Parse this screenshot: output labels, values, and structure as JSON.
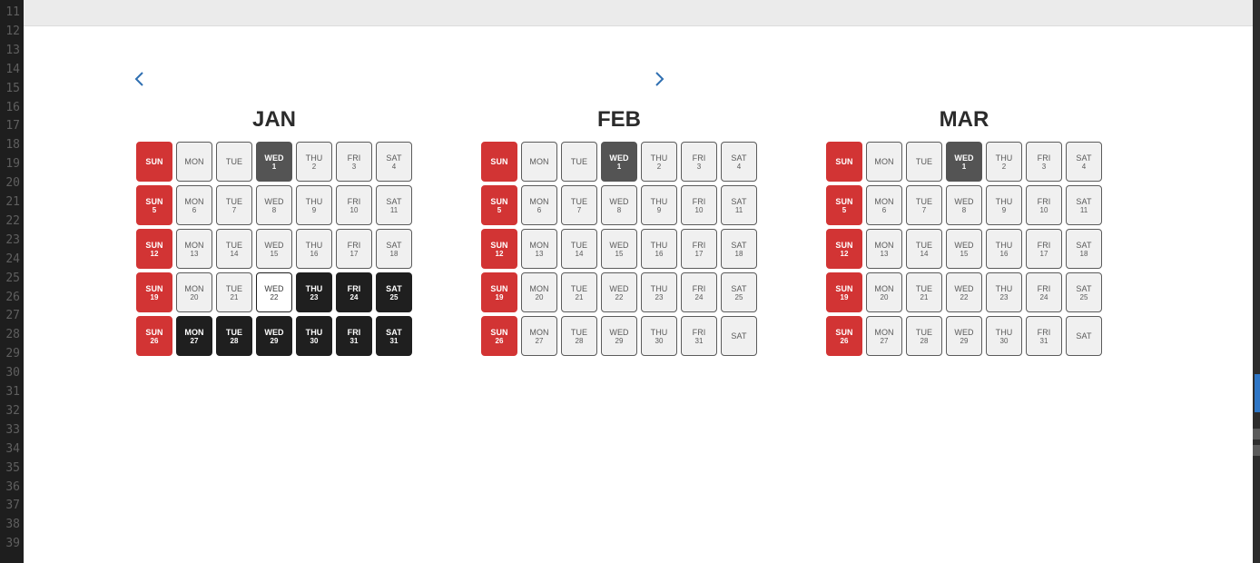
{
  "gutter_lines": [
    "11",
    "12",
    "13",
    "14",
    "15",
    "16",
    "17",
    "18",
    "19",
    "20",
    "21",
    "22",
    "23",
    "24",
    "25",
    "26",
    "27",
    "28",
    "29",
    "30",
    "31",
    "32",
    "33",
    "34",
    "35",
    "36",
    "37",
    "38",
    "39"
  ],
  "nav": {
    "prev_icon": "chevron-left-icon",
    "next_icon": "chevron-right-icon"
  },
  "colors": {
    "sunday": "#d23434",
    "first_wed": "#545454",
    "selected": "#1f1f1f",
    "accent": "#2f76c5"
  },
  "months": [
    {
      "name": "JAN",
      "weeks": [
        [
          {
            "d": "SUN",
            "n": "",
            "s": "sun"
          },
          {
            "d": "MON",
            "n": ""
          },
          {
            "d": "TUE",
            "n": ""
          },
          {
            "d": "WED",
            "n": "1",
            "s": "wed1"
          },
          {
            "d": "THU",
            "n": "2"
          },
          {
            "d": "FRI",
            "n": "3"
          },
          {
            "d": "SAT",
            "n": "4"
          }
        ],
        [
          {
            "d": "SUN",
            "n": "5",
            "s": "sun"
          },
          {
            "d": "MON",
            "n": "6"
          },
          {
            "d": "TUE",
            "n": "7"
          },
          {
            "d": "WED",
            "n": "8"
          },
          {
            "d": "THU",
            "n": "9"
          },
          {
            "d": "FRI",
            "n": "10"
          },
          {
            "d": "SAT",
            "n": "11"
          }
        ],
        [
          {
            "d": "SUN",
            "n": "12",
            "s": "sun"
          },
          {
            "d": "MON",
            "n": "13"
          },
          {
            "d": "TUE",
            "n": "14"
          },
          {
            "d": "WED",
            "n": "15"
          },
          {
            "d": "THU",
            "n": "16"
          },
          {
            "d": "FRI",
            "n": "17"
          },
          {
            "d": "SAT",
            "n": "18"
          }
        ],
        [
          {
            "d": "SUN",
            "n": "19",
            "s": "sun"
          },
          {
            "d": "MON",
            "n": "20"
          },
          {
            "d": "TUE",
            "n": "21"
          },
          {
            "d": "WED",
            "n": "22",
            "s": "today"
          },
          {
            "d": "THU",
            "n": "23",
            "s": "sel"
          },
          {
            "d": "FRI",
            "n": "24",
            "s": "sel"
          },
          {
            "d": "SAT",
            "n": "25",
            "s": "sel"
          }
        ],
        [
          {
            "d": "SUN",
            "n": "26",
            "s": "sun"
          },
          {
            "d": "MON",
            "n": "27",
            "s": "sel"
          },
          {
            "d": "TUE",
            "n": "28",
            "s": "sel"
          },
          {
            "d": "WED",
            "n": "29",
            "s": "sel"
          },
          {
            "d": "THU",
            "n": "30",
            "s": "sel"
          },
          {
            "d": "FRI",
            "n": "31",
            "s": "sel"
          },
          {
            "d": "SAT",
            "n": "31",
            "s": "sel"
          }
        ]
      ]
    },
    {
      "name": "FEB",
      "weeks": [
        [
          {
            "d": "SUN",
            "n": "",
            "s": "sun"
          },
          {
            "d": "MON",
            "n": ""
          },
          {
            "d": "TUE",
            "n": ""
          },
          {
            "d": "WED",
            "n": "1",
            "s": "wed1"
          },
          {
            "d": "THU",
            "n": "2"
          },
          {
            "d": "FRI",
            "n": "3"
          },
          {
            "d": "SAT",
            "n": "4"
          }
        ],
        [
          {
            "d": "SUN",
            "n": "5",
            "s": "sun"
          },
          {
            "d": "MON",
            "n": "6"
          },
          {
            "d": "TUE",
            "n": "7"
          },
          {
            "d": "WED",
            "n": "8"
          },
          {
            "d": "THU",
            "n": "9"
          },
          {
            "d": "FRI",
            "n": "10"
          },
          {
            "d": "SAT",
            "n": "11"
          }
        ],
        [
          {
            "d": "SUN",
            "n": "12",
            "s": "sun"
          },
          {
            "d": "MON",
            "n": "13"
          },
          {
            "d": "TUE",
            "n": "14"
          },
          {
            "d": "WED",
            "n": "15"
          },
          {
            "d": "THU",
            "n": "16"
          },
          {
            "d": "FRI",
            "n": "17"
          },
          {
            "d": "SAT",
            "n": "18"
          }
        ],
        [
          {
            "d": "SUN",
            "n": "19",
            "s": "sun"
          },
          {
            "d": "MON",
            "n": "20"
          },
          {
            "d": "TUE",
            "n": "21"
          },
          {
            "d": "WED",
            "n": "22"
          },
          {
            "d": "THU",
            "n": "23"
          },
          {
            "d": "FRI",
            "n": "24"
          },
          {
            "d": "SAT",
            "n": "25"
          }
        ],
        [
          {
            "d": "SUN",
            "n": "26",
            "s": "sun"
          },
          {
            "d": "MON",
            "n": "27"
          },
          {
            "d": "TUE",
            "n": "28"
          },
          {
            "d": "WED",
            "n": "29"
          },
          {
            "d": "THU",
            "n": "30"
          },
          {
            "d": "FRI",
            "n": "31"
          },
          {
            "d": "SAT",
            "n": ""
          }
        ]
      ]
    },
    {
      "name": "MAR",
      "weeks": [
        [
          {
            "d": "SUN",
            "n": "",
            "s": "sun"
          },
          {
            "d": "MON",
            "n": ""
          },
          {
            "d": "TUE",
            "n": ""
          },
          {
            "d": "WED",
            "n": "1",
            "s": "wed1"
          },
          {
            "d": "THU",
            "n": "2"
          },
          {
            "d": "FRI",
            "n": "3"
          },
          {
            "d": "SAT",
            "n": "4"
          }
        ],
        [
          {
            "d": "SUN",
            "n": "5",
            "s": "sun"
          },
          {
            "d": "MON",
            "n": "6"
          },
          {
            "d": "TUE",
            "n": "7"
          },
          {
            "d": "WED",
            "n": "8"
          },
          {
            "d": "THU",
            "n": "9"
          },
          {
            "d": "FRI",
            "n": "10"
          },
          {
            "d": "SAT",
            "n": "11"
          }
        ],
        [
          {
            "d": "SUN",
            "n": "12",
            "s": "sun"
          },
          {
            "d": "MON",
            "n": "13"
          },
          {
            "d": "TUE",
            "n": "14"
          },
          {
            "d": "WED",
            "n": "15"
          },
          {
            "d": "THU",
            "n": "16"
          },
          {
            "d": "FRI",
            "n": "17"
          },
          {
            "d": "SAT",
            "n": "18"
          }
        ],
        [
          {
            "d": "SUN",
            "n": "19",
            "s": "sun"
          },
          {
            "d": "MON",
            "n": "20"
          },
          {
            "d": "TUE",
            "n": "21"
          },
          {
            "d": "WED",
            "n": "22"
          },
          {
            "d": "THU",
            "n": "23"
          },
          {
            "d": "FRI",
            "n": "24"
          },
          {
            "d": "SAT",
            "n": "25"
          }
        ],
        [
          {
            "d": "SUN",
            "n": "26",
            "s": "sun"
          },
          {
            "d": "MON",
            "n": "27"
          },
          {
            "d": "TUE",
            "n": "28"
          },
          {
            "d": "WED",
            "n": "29"
          },
          {
            "d": "THU",
            "n": "30"
          },
          {
            "d": "FRI",
            "n": "31"
          },
          {
            "d": "SAT",
            "n": ""
          }
        ]
      ]
    }
  ]
}
